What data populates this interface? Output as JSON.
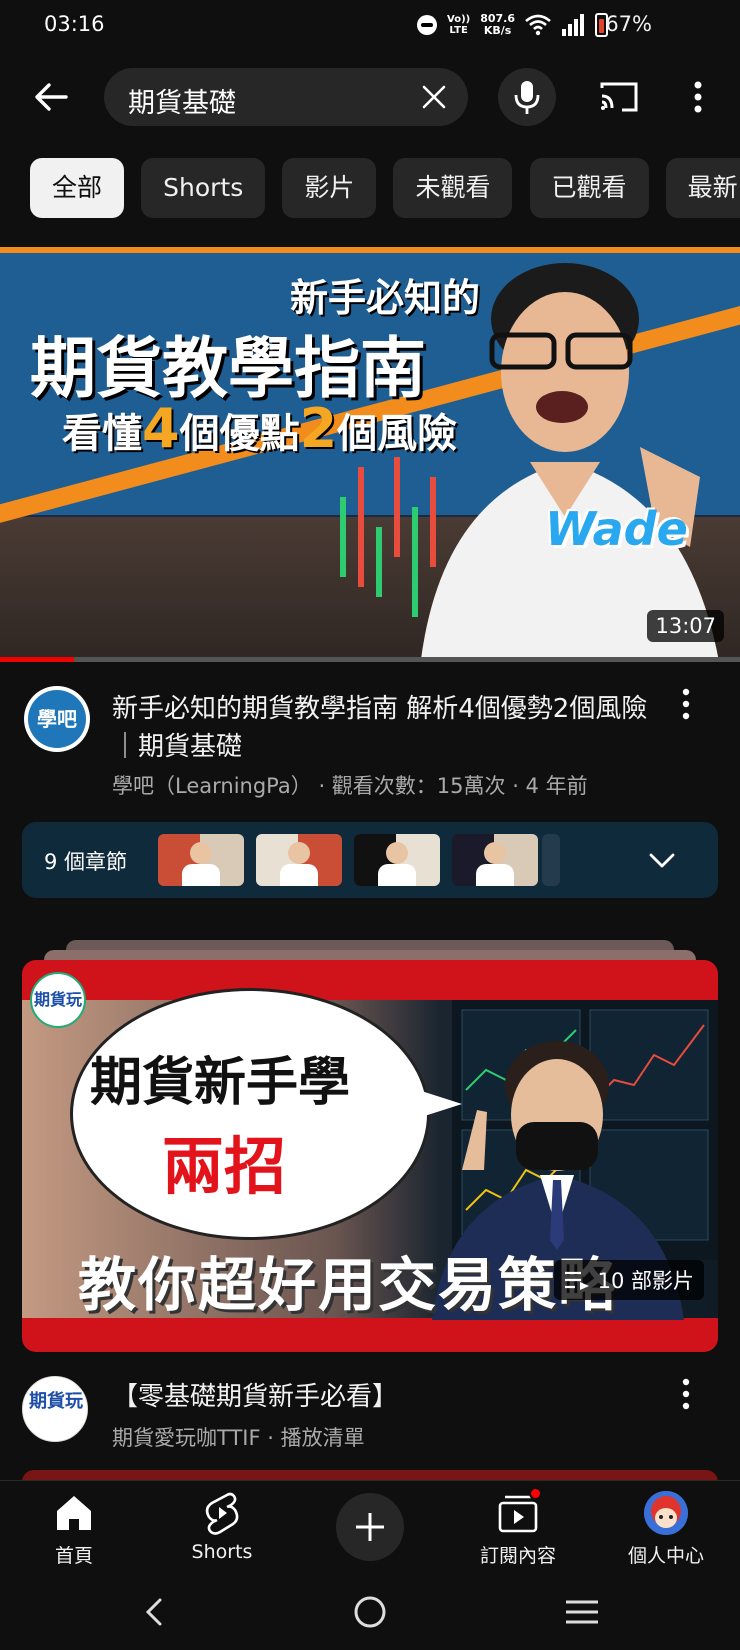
{
  "status": {
    "time": "03:16",
    "network_type_top": "Vo))",
    "network_type_bottom": "LTE",
    "speed_value": "807.6",
    "speed_unit": "KB/s",
    "battery": "67%"
  },
  "search": {
    "query": "期貨基礎"
  },
  "chips": [
    "全部",
    "Shorts",
    "影片",
    "未觀看",
    "已觀看",
    "最新"
  ],
  "video1": {
    "thumb_line1": "新手必知的",
    "thumb_line2": "期貨教學指南",
    "thumb_line3_a": "看懂",
    "thumb_line3_b": "4",
    "thumb_line3_c": "個優點",
    "thumb_line3_d": "2",
    "thumb_line3_e": "個風險",
    "thumb_name": "Wade",
    "duration": "13:07",
    "progress": 0.1,
    "title": "新手必知的期貨教學指南 解析4個優勢2個風險｜期貨基礎",
    "channel": "學吧（LearningPa）",
    "views_age": " · 觀看次數：15萬次 · 4 年前",
    "avatar_text": "學吧",
    "chapters_label": "9 個章節"
  },
  "playlist": {
    "logo_text": "期貨玩",
    "thumb_line1": "期貨新手學",
    "thumb_line2": "兩招",
    "thumb_line3": "教你超好用交易策略",
    "count": "10 部影片",
    "title": "【零基礎期貨新手必看】",
    "subtitle": "期貨愛玩咖TTIF · 播放清單",
    "avatar_text": "期貨玩"
  },
  "nav": {
    "home": "首頁",
    "shorts": "Shorts",
    "subscriptions": "訂閱內容",
    "you": "個人中心"
  },
  "colors": {
    "background": "#0f0f0f",
    "chip": "#272727",
    "accent_red": "#ff0000",
    "chapters_bg": "#0f2a3b"
  }
}
